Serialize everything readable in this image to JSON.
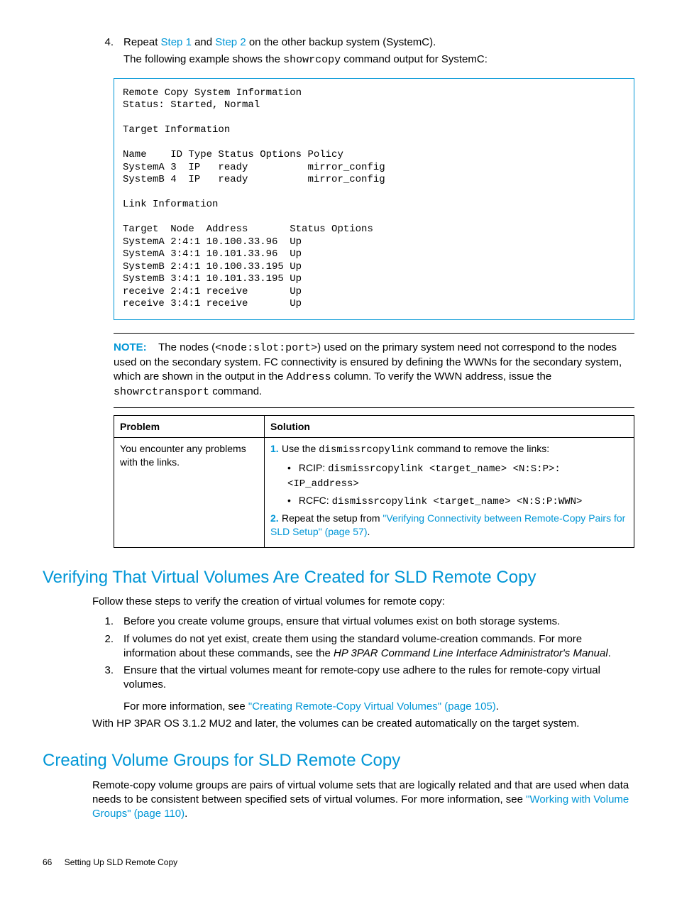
{
  "step4": {
    "num": "4.",
    "line1_a": "Repeat ",
    "link1": "Step 1",
    "line1_b": " and ",
    "link2": "Step 2",
    "line1_c": " on the other backup system (SystemC).",
    "line2_a": "The following example shows the ",
    "cmd": "showrcopy",
    "line2_b": " command output for SystemC:"
  },
  "code1": "Remote Copy System Information\nStatus: Started, Normal\n\nTarget Information\n\nName    ID Type Status Options Policy\nSystemA 3  IP   ready          mirror_config\nSystemB 4  IP   ready          mirror_config\n\nLink Information\n\nTarget  Node  Address       Status Options\nSystemA 2:4:1 10.100.33.96  Up\nSystemA 3:4:1 10.101.33.96  Up\nSystemB 2:4:1 10.100.33.195 Up\nSystemB 3:4:1 10.101.33.195 Up\nreceive 2:4:1 receive       Up\nreceive 3:4:1 receive       Up",
  "note": {
    "label": "NOTE:",
    "t1": "The nodes (",
    "c1": "<node:slot:port>",
    "t2": ") used on the primary system need not correspond to the nodes used on the secondary system. FC connectivity is ensured by defining the WWNs for the secondary system, which are shown in the output in the ",
    "c2": "Address",
    "t3": " column. To verify the WWN address, issue the ",
    "c3": "showrctransport",
    "t4": " command."
  },
  "table": {
    "h1": "Problem",
    "h2": "Solution",
    "problem": "You encounter any problems with the links.",
    "s1a": "Use the ",
    "s1cmd": "dismissrcopylink",
    "s1b": " command to remove the links:",
    "rcip_a": "RCIP: ",
    "rcip_cmd": "dismissrcopylink <target_name> <N:S:P>:<IP_address>",
    "rcfc_a": "RCFC: ",
    "rcfc_cmd": "dismissrcopylink <target_name> <N:S:P:WWN>",
    "s2a": "Repeat the setup from ",
    "s2link": "\"Verifying Connectivity between Remote-Copy Pairs for SLD Setup\" (page 57)",
    "s2b": "."
  },
  "sec1": {
    "title": "Verifying That Virtual Volumes Are Created for SLD Remote Copy",
    "intro": "Follow these steps to verify the creation of virtual volumes for remote copy:",
    "i1": "Before you create volume groups, ensure that virtual volumes exist on both storage systems.",
    "i2a": "If volumes do not yet exist, create them using the standard volume-creation commands. For more information about these commands, see the ",
    "i2em": "HP 3PAR Command Line Interface Administrator's Manual",
    "i2b": ".",
    "i3": "Ensure that the virtual volumes meant for remote-copy use adhere to the rules for remote-copy virtual volumes.",
    "i3more_a": "For more information, see ",
    "i3link": "\"Creating Remote-Copy Virtual Volumes\" (page 105)",
    "i3more_b": ".",
    "tail": "With HP 3PAR OS 3.1.2 MU2 and later, the volumes can be created automatically on the target system."
  },
  "sec2": {
    "title": "Creating Volume Groups for SLD Remote Copy",
    "p_a": "Remote-copy volume groups are pairs of virtual volume sets that are logically related and that are used when data needs to be consistent between specified sets of virtual volumes. For more information, see ",
    "link": "\"Working with Volume Groups\" (page 110)",
    "p_b": "."
  },
  "footer": {
    "page": "66",
    "title": "Setting Up SLD Remote Copy"
  }
}
